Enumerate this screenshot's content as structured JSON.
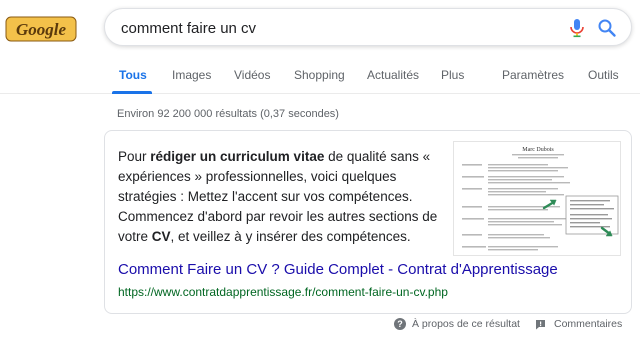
{
  "logo": {
    "text": "Google"
  },
  "search": {
    "query": "comment faire un cv"
  },
  "tabs": [
    {
      "label": "Tous",
      "active": true
    },
    {
      "label": "Images"
    },
    {
      "label": "Vidéos"
    },
    {
      "label": "Shopping"
    },
    {
      "label": "Actualités"
    },
    {
      "label": "Plus"
    },
    {
      "label": "Paramètres"
    },
    {
      "label": "Outils"
    }
  ],
  "result_stats": "Environ 92 200 000 résultats (0,37 secondes)",
  "featured": {
    "snippet_parts": [
      "Pour ",
      "rédiger un curriculum vitae",
      " de qualité sans « expériences » professionnelles, voici quelques stratégies : Mettez l'accent sur vos compétences. Commencez d'abord par revoir les autres sections de votre ",
      "CV",
      ", et veillez à y insérer des compétences."
    ],
    "title": "Comment Faire un CV ? Guide Complet - Contrat d'Apprentissage",
    "url": "https://www.contratdapprentissage.fr/comment-faire-un-cv.php",
    "thumbnail_heading": "Marc Dubois"
  },
  "footer": {
    "about": "À propos de ce résultat",
    "feedback": "Commentaires"
  },
  "colors": {
    "accent": "#1a73e8",
    "link": "#1a0dab",
    "url_green": "#006621",
    "logo_gold": "#e2a323",
    "logo_dark": "#5b3a0c"
  }
}
